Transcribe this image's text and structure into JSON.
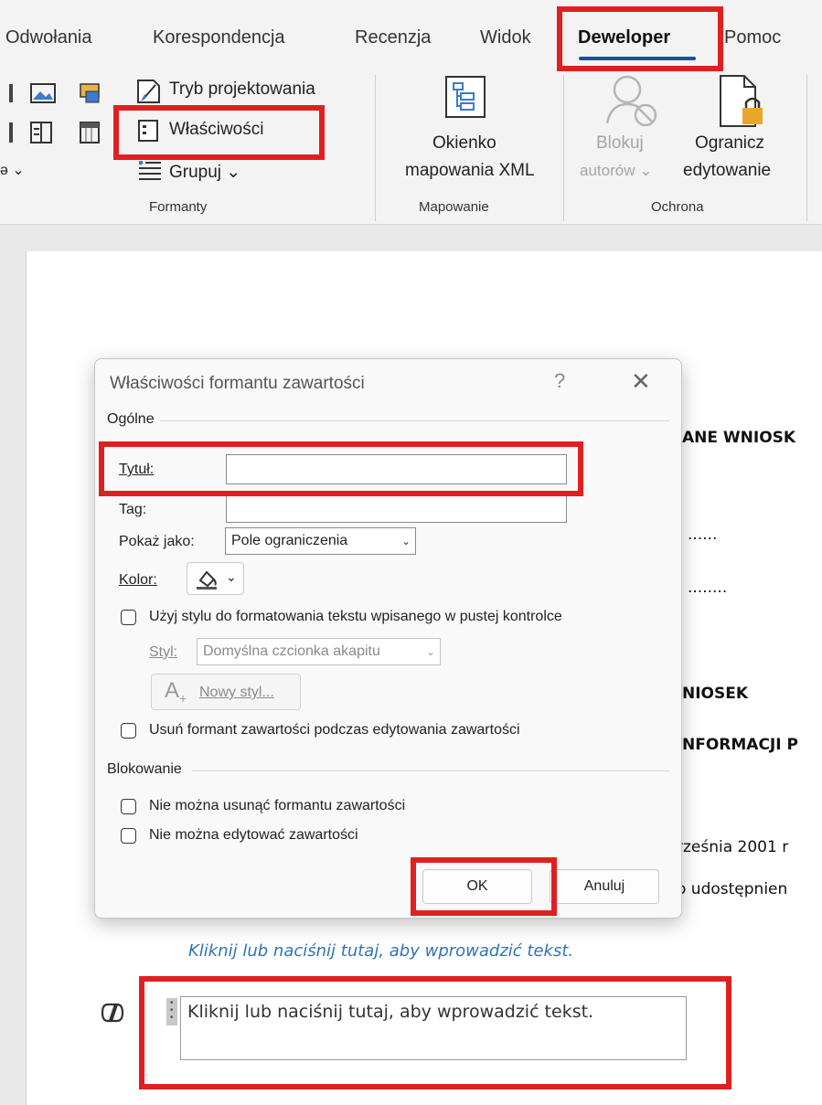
{
  "ribbon": {
    "tabs": [
      {
        "label": "Odwołania"
      },
      {
        "label": "Korespondencja"
      },
      {
        "label": "Recenzja"
      },
      {
        "label": "Widok"
      },
      {
        "label": "Deweloper",
        "active": true
      },
      {
        "label": "Pomoc"
      }
    ],
    "formanty": {
      "design_mode": "Tryb projektowania",
      "properties": "Właściwości",
      "group": "Grupuj",
      "group_label": "Formanty"
    },
    "mapowanie": {
      "xml_pane_line1": "Okienko",
      "xml_pane_line2": "mapowania XML",
      "group_label": "Mapowanie"
    },
    "ochrona": {
      "block_authors_line1": "Blokuj",
      "block_authors_line2": "autorów",
      "restrict_line1": "Ogranicz",
      "restrict_line2": "edytowanie",
      "group_label": "Ochrona"
    }
  },
  "document": {
    "line1": "ANE WNIOSK",
    "line2": "......",
    "line3": "........",
    "line4": "NIOSEK",
    "line5": "NFORMACJI P",
    "line6": "rześnia 2001 r",
    "line7": "o udostępnien",
    "placeholder_blue": "Kliknij lub naciśnij tutaj, aby wprowadzić tekst.",
    "content_control_text": "Kliknij lub naciśnij tutaj, aby wprowadzić tekst."
  },
  "dialog": {
    "title": "Właściwości formantu zawartości",
    "help": "?",
    "close": "✕",
    "general_group": "Ogólne",
    "title_label": "Tytuł:",
    "title_value": "",
    "tag_label": "Tag:",
    "tag_value": "",
    "show_as_label": "Pokaż jako:",
    "show_as_value": "Pole ograniczenia",
    "color_label": "Kolor:",
    "use_style_label": "Użyj stylu do formatowania tekstu wpisanego w pustej kontrolce",
    "style_label": "Styl:",
    "style_value": "Domyślna czcionka akapitu",
    "new_style_button": "Nowy styl...",
    "remove_control_label": "Usuń formant zawartości podczas edytowania zawartości",
    "locking_group": "Blokowanie",
    "cannot_delete_label": "Nie można usunąć formantu zawartości",
    "cannot_edit_label": "Nie można edytować zawartości",
    "ok_button": "OK",
    "cancel_button": "Anuluj"
  },
  "colors": {
    "annotation_red": "#e02020",
    "accent_underline": "#1f4e9e",
    "placeholder_blue": "#2e74b5"
  },
  "icons": [
    "picture-icon",
    "table-icon",
    "design-mode-icon",
    "properties-icon",
    "group-icon",
    "xml-mapping-icon",
    "block-authors-icon",
    "restrict-editing-icon",
    "paint-bucket-icon",
    "copilot-icon"
  ]
}
